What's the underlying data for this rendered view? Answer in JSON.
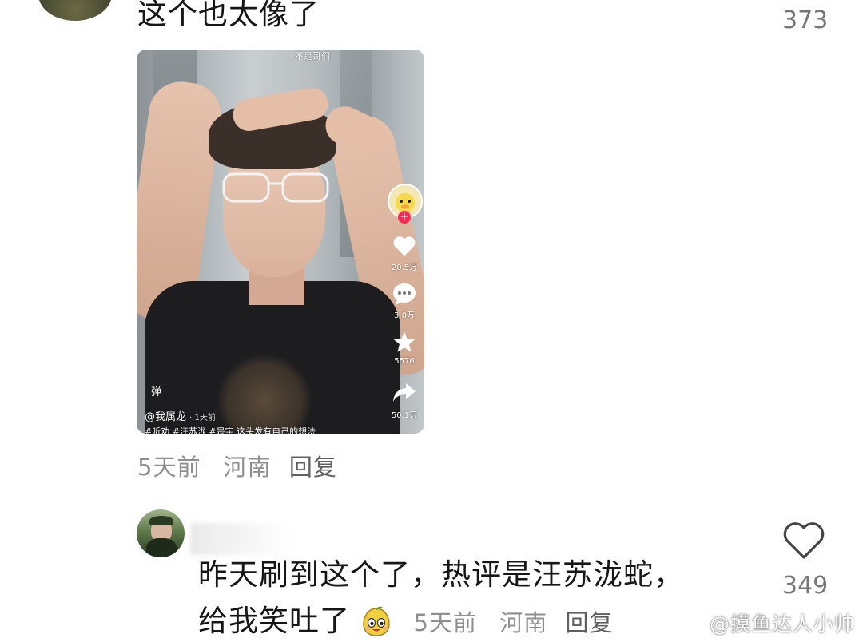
{
  "comment_top": {
    "text": "这个也太像了",
    "like_count": "373",
    "meta": {
      "time": "5天前",
      "location": "河南",
      "reply": "回复"
    }
  },
  "video": {
    "top_caption": "不是哥们",
    "danmaku_label": "弹",
    "author": "@我属龙",
    "posted": "· 1天前",
    "hashtags": "#听劝 #汪苏泷 #是宇 这头发有自己的想法",
    "likes": "20.5万",
    "comments": "3.0万",
    "favorites": "5576",
    "shares": "50.1万"
  },
  "comment_second": {
    "text_line1": "昨天刷到这个了，热评是汪苏泷蛇，",
    "text_line2": "给我笑吐了",
    "like_count": "349",
    "meta": {
      "time": "5天前",
      "location": "河南",
      "reply": "回复"
    }
  },
  "watermark": "@摸鱼达人小帅",
  "icons": {
    "heart": "heart-outline-icon",
    "emoji": "smiling-mango-emoji-icon",
    "video_like": "heart-icon",
    "video_comment": "comment-bubble-icon",
    "video_favorite": "star-icon",
    "video_share": "share-arrow-icon"
  }
}
